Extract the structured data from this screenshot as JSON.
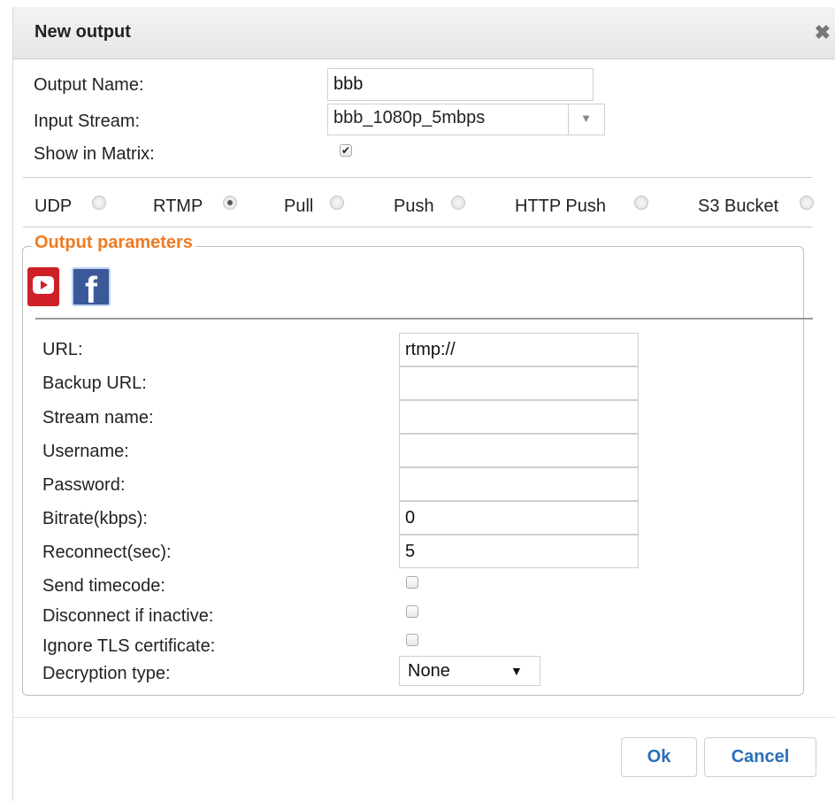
{
  "dialog": {
    "title": "New output",
    "close_glyph": "✖"
  },
  "form": {
    "output_name": {
      "label": "Output Name:",
      "value": "bbb"
    },
    "input_stream": {
      "label": "Input Stream:",
      "value": "bbb_1080p_5mbps",
      "arrow_icon": "chevron-down-icon"
    },
    "show_in_matrix": {
      "label": "Show in Matrix:",
      "checked": true
    }
  },
  "protocols": [
    {
      "label": "UDP",
      "selected": false
    },
    {
      "label": "RTMP",
      "selected": true
    },
    {
      "label": "Pull",
      "selected": false
    },
    {
      "label": "Push",
      "selected": false
    },
    {
      "label": "HTTP Push",
      "selected": false
    },
    {
      "label": "S3 Bucket",
      "selected": false
    }
  ],
  "params": {
    "legend": "Output parameters",
    "presets": [
      {
        "name": "youtube",
        "icon": "youtube-icon"
      },
      {
        "name": "facebook",
        "icon": "facebook-icon",
        "glyph": "f"
      }
    ],
    "url": {
      "label": "URL:",
      "value": "rtmp://"
    },
    "backup_url": {
      "label": "Backup URL:",
      "value": ""
    },
    "stream_name": {
      "label": "Stream name:",
      "value": ""
    },
    "username": {
      "label": "Username:",
      "value": ""
    },
    "password": {
      "label": "Password:",
      "value": ""
    },
    "bitrate": {
      "label": "Bitrate(kbps):",
      "value": "0"
    },
    "reconnect": {
      "label": "Reconnect(sec):",
      "value": "5"
    },
    "send_timecode": {
      "label": "Send timecode:",
      "checked": false
    },
    "disconnect_inactive": {
      "label": "Disconnect if inactive:",
      "checked": false
    },
    "ignore_tls": {
      "label": "Ignore TLS certificate:",
      "checked": false
    },
    "decryption_type": {
      "label": "Decryption type:",
      "value": "None",
      "arrow": "▼"
    }
  },
  "buttons": {
    "ok": "Ok",
    "cancel": "Cancel"
  },
  "colors": {
    "legend": "#ef7b22",
    "button_text": "#2a6ebb",
    "youtube": "#cf2027",
    "facebook": "#3b5998"
  }
}
